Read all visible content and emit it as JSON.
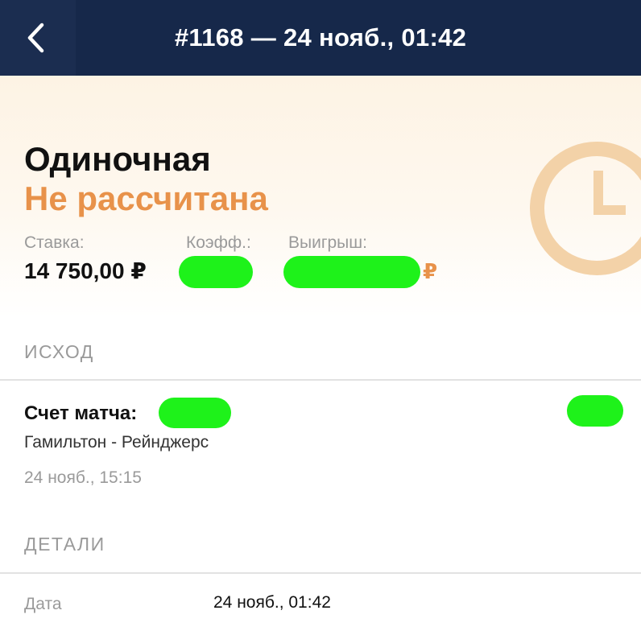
{
  "header": {
    "title": "#1168 — 24 нояб., 01:42",
    "back_icon": "chevron-left-icon"
  },
  "bet": {
    "type": "Одиночная",
    "status": "Не рассчитана",
    "stake_label": "Ставка:",
    "stake_value": "14 750,00 ₽",
    "coef_label": "Коэфф.:",
    "win_label": "Выигрыш:",
    "win_currency": "₽",
    "status_icon": "clock-icon"
  },
  "outcome": {
    "section_label": "ИСХОД",
    "title": "Счет матча:",
    "teams": "Гамильтон - Рейнджерс",
    "datetime": "24 нояб., 15:15"
  },
  "details": {
    "section_label": "ДЕТАЛИ",
    "date_label": "Дата",
    "date_value": "24 нояб., 01:42"
  },
  "colors": {
    "header_bg": "#16284a",
    "accent_orange": "#e8924a",
    "redaction_green": "#1ef21a"
  }
}
